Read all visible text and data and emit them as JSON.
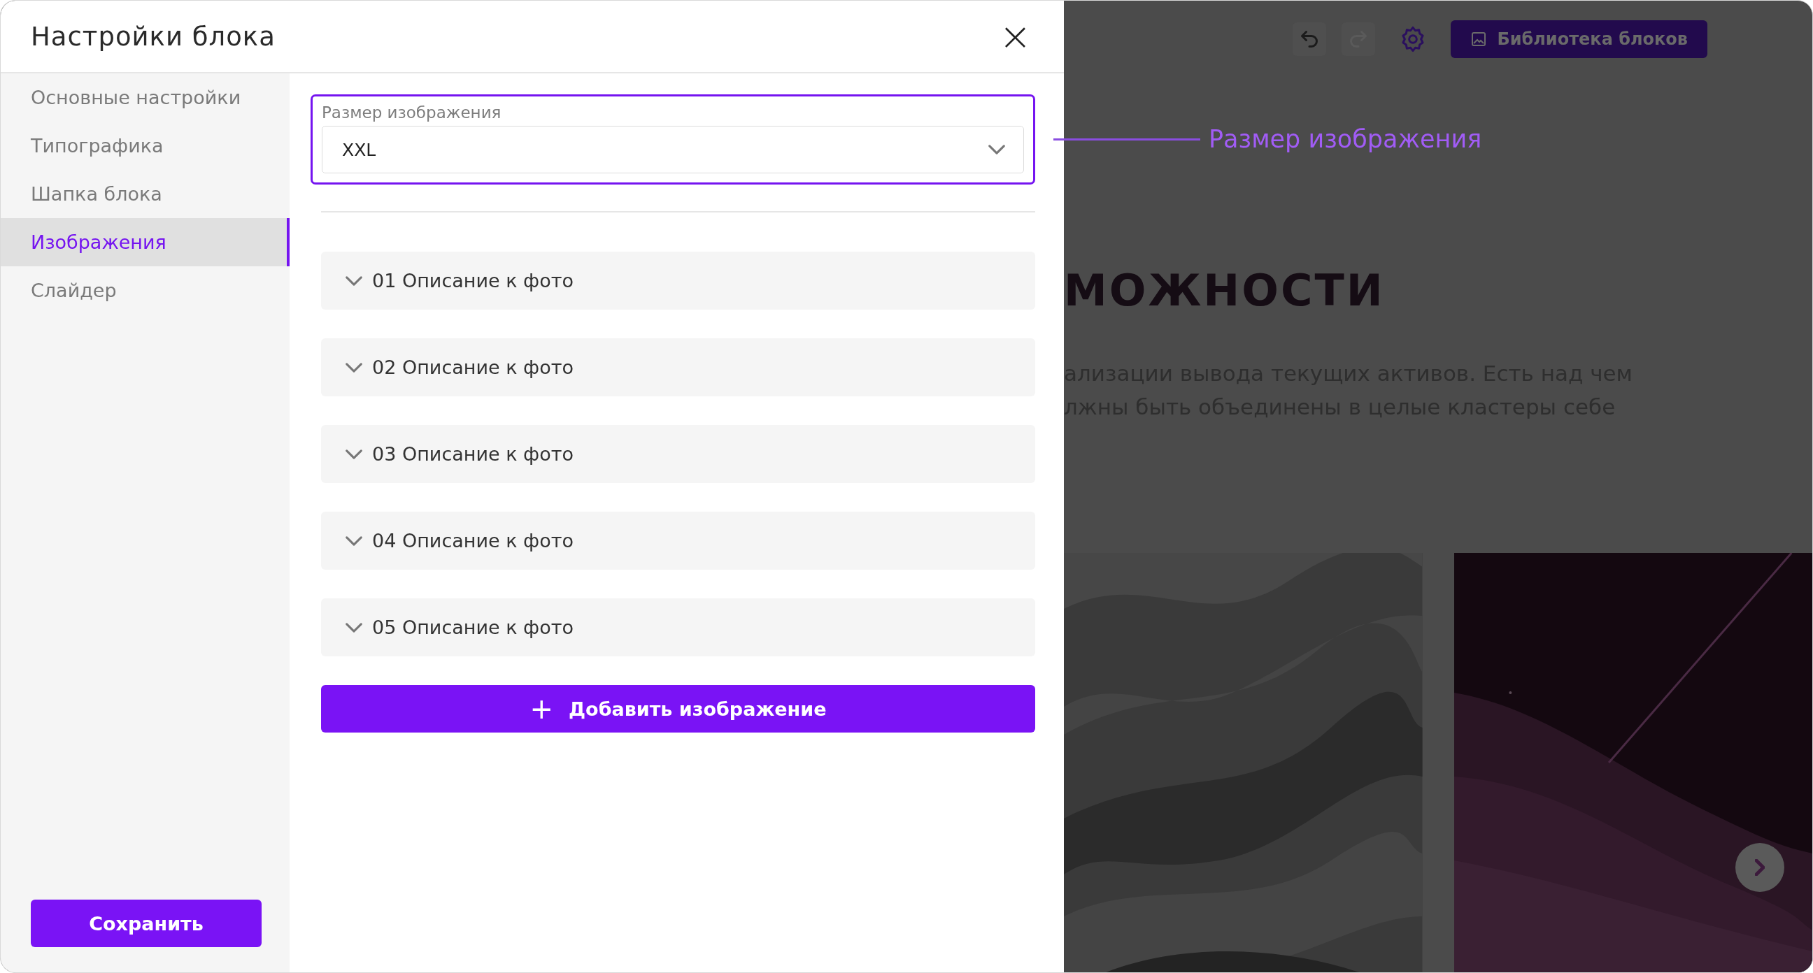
{
  "dialog": {
    "title": "Настройки блока",
    "close": "×",
    "sidebar": {
      "items": [
        {
          "label": "Основные настройки",
          "selected": false
        },
        {
          "label": "Типографика",
          "selected": false
        },
        {
          "label": "Шапка блока",
          "selected": false
        },
        {
          "label": "Изображения",
          "selected": true
        },
        {
          "label": "Слайдер",
          "selected": false
        }
      ]
    },
    "image_size": {
      "label": "Размер изображения",
      "value": "XXL"
    },
    "images": [
      {
        "label": "01 Описание к фото"
      },
      {
        "label": "02 Описание к фото"
      },
      {
        "label": "03 Описание к фото"
      },
      {
        "label": "04 Описание к фото"
      },
      {
        "label": "05 Описание к фото"
      }
    ],
    "add_button": {
      "icon": "+",
      "label": "Добавить изображение"
    },
    "save_button": "Сохранить"
  },
  "annotation": "Размер изображения",
  "background_page": {
    "toolbar": {
      "library_button": "Библиотека блоков"
    },
    "heading": "МОЖНОСТИ",
    "paragraph_lines": [
      "ализации вывода текущих активов. Есть над чем",
      "лжны быть объединены в целые кластеры себе"
    ]
  }
}
